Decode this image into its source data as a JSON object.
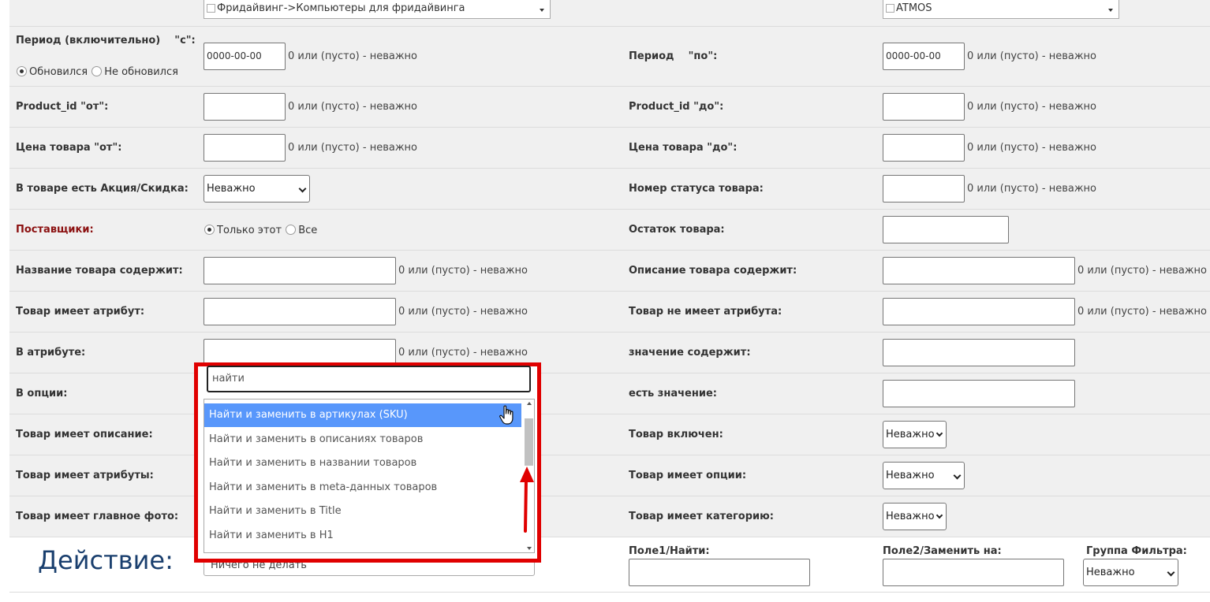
{
  "top_row": {
    "category_select": "Фридайвинг->Компьютеры для фридайвинга",
    "manufacturer_select": "ATMOS"
  },
  "hint_text": "0 или (пусто) - неважно",
  "period": {
    "from_label": "Период (включительно)    \"с\":",
    "from_value": "0000-00-00",
    "radio_updated": "Обновился",
    "radio_not_updated": "Не обновился",
    "to_label": "Период    \"по\":",
    "to_value": "0000-00-00"
  },
  "product_id": {
    "from_label": "Product_id \"от\":",
    "to_label": "Product_id \"до\":"
  },
  "price": {
    "from_label": "Цена товара \"от\":",
    "to_label": "Цена товара \"до\":"
  },
  "promo": {
    "label": "В товаре есть Акция/Скидка:",
    "value": "Неважно",
    "status_label": "Номер статуса товара:"
  },
  "suppliers": {
    "label": "Поставщики:",
    "only_this": "Только этот",
    "all": "Все",
    "stock_label": "Остаток товара:"
  },
  "name_contains": {
    "label": "Название товара содержит:",
    "desc_label": "Описание товара содержит:"
  },
  "attribute": {
    "has_label": "Товар имеет атрибут:",
    "has_not_label": "Товар не имеет атрибута:"
  },
  "in_attribute": {
    "label": "В атрибуте:",
    "value_contains_label": "значение содержит:"
  },
  "in_option": {
    "label": "В опции:",
    "has_value_label": "есть значение:"
  },
  "has_description": {
    "label": "Товар имеет описание:",
    "enabled_label": "Товар включен:",
    "enabled_value": "Неважно"
  },
  "has_attributes": {
    "label": "Товар имеет атрибуты:",
    "options_label": "Товар имеет опции:",
    "options_value": "Неважно"
  },
  "has_photo": {
    "label": "Товар имеет главное фото:",
    "category_label": "Товар имеет категорию:",
    "category_value": "Неважно"
  },
  "action": {
    "title": "Действие:",
    "select_value": "Ничего не делать",
    "field1_label": "Поле1/Найти:",
    "field2_label": "Поле2/Заменить на:",
    "group_label": "Группа Фильтра:",
    "group_value": "Неважно"
  },
  "dropdown": {
    "search_value": "найти",
    "items": [
      "Найти и заменить в артикулах (SKU)",
      "Найти и заменить в описаниях товаров",
      "Найти и заменить в названии товаров",
      "Найти и заменить в meta-данных товаров",
      "Найти и заменить в Title",
      "Найти и заменить в H1"
    ],
    "highlighted_index": 0
  },
  "colors": {
    "highlight": "#5897fb",
    "frame": "#e00000",
    "arrow": "#e00000",
    "action_title": "#1a3f6e",
    "supplier_label": "#8b1010"
  }
}
